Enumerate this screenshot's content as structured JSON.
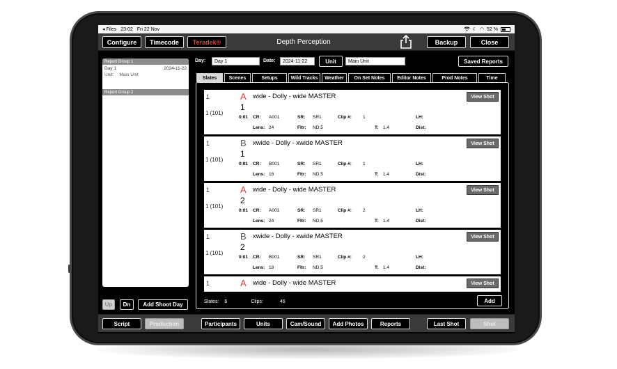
{
  "status_bar": {
    "app_back": "◂ Files",
    "time": "23:02",
    "date": "Fri 22 Nov",
    "battery_pct": "52 %",
    "battery_level": 0.52
  },
  "header": {
    "configure": "Configure",
    "timecode": "Timecode",
    "teradek": "Teradek®",
    "title": "Depth Perception",
    "backup": "Backup",
    "close": "Close"
  },
  "left_panel": {
    "groups": [
      {
        "header": "Report Group 1",
        "items": [
          {
            "name": "Day 1",
            "date": "2024-11-22",
            "unit_label": "Unit:",
            "unit_value": "Main Unit"
          }
        ]
      },
      {
        "header": "Report Group 2",
        "items": []
      }
    ],
    "up": "Up",
    "dn": "Dn",
    "add_shoot_day": "Add Shoot Day"
  },
  "filters": {
    "day_label": "Day:",
    "day_value": "Day 1",
    "date_label": "Date:",
    "date_value": "2024-11-22",
    "unit_button": "Unit",
    "unit_value": "Main Unit",
    "saved_reports": "Saved Reports"
  },
  "tabs": [
    {
      "label": "Slates",
      "active": true
    },
    {
      "label": "Scenes",
      "active": false
    },
    {
      "label": "Setups",
      "active": false
    },
    {
      "label": "Wild Tracks",
      "active": false
    },
    {
      "label": "Weather",
      "active": false
    },
    {
      "label": "On Set Notes",
      "active": false
    },
    {
      "label": "Editor Notes",
      "active": false
    },
    {
      "label": "Prod Notes",
      "active": false
    },
    {
      "label": "Time",
      "active": false
    }
  ],
  "field_labels": {
    "cr": "CR:",
    "sr": "SR:",
    "clip": "Clip #:",
    "lh": "LH:",
    "lens": "Lens:",
    "fltr": "Fltr:",
    "t": "T:",
    "dist": "Dist:"
  },
  "slates": [
    {
      "scene": "1",
      "letter": "A",
      "letter_color": "#e23b3b",
      "title": "wide - Dolly - wide MASTER",
      "take": "1",
      "take_id": "1 (101)",
      "duration": "0:01",
      "cr": "A001",
      "sr": "SR1",
      "clip": "1",
      "lh": "",
      "lens": "24",
      "fltr": "ND.5",
      "t": "1.4",
      "dist": "",
      "view": "View Shot"
    },
    {
      "scene": "1",
      "letter": "B",
      "letter_color": "#555555",
      "title": "xwide - Dolly - xwide MASTER",
      "take": "1",
      "take_id": "1 (101)",
      "duration": "0:01",
      "cr": "B001",
      "sr": "SR1",
      "clip": "1",
      "lh": "",
      "lens": "18",
      "fltr": "ND.5",
      "t": "1.4",
      "dist": "",
      "view": "View Shot"
    },
    {
      "scene": "1",
      "letter": "A",
      "letter_color": "#e23b3b",
      "title": "wide - Dolly - wide MASTER",
      "take": "2",
      "take_id": "1 (101)",
      "duration": "0:01",
      "cr": "A001",
      "sr": "SR1",
      "clip": "2",
      "lh": "",
      "lens": "24",
      "fltr": "ND.5",
      "t": "1.4",
      "dist": "",
      "view": "View Shot"
    },
    {
      "scene": "1",
      "letter": "B",
      "letter_color": "#555555",
      "title": "xwide - Dolly - xwide MASTER",
      "take": "2",
      "take_id": "1 (101)",
      "duration": "0:01",
      "cr": "B001",
      "sr": "SR1",
      "clip": "2",
      "lh": "",
      "lens": "18",
      "fltr": "ND.5",
      "t": "1.4",
      "dist": "",
      "view": "View Shot"
    },
    {
      "scene": "1",
      "letter": "A",
      "letter_color": "#e23b3b",
      "title": "wide - Dolly - wide MASTER",
      "take": "",
      "take_id": "",
      "duration": "",
      "cr": "",
      "sr": "",
      "clip": "",
      "lh": "",
      "lens": "",
      "fltr": "",
      "t": "",
      "dist": "",
      "view": "View Shot"
    }
  ],
  "summary": {
    "slates_label": "Slates:",
    "slates_value": "6",
    "clips_label": "Clips:",
    "clips_value": "46",
    "add": "Add"
  },
  "bottom_bar": {
    "script": "Script",
    "production": "Production",
    "participants": "Participants",
    "units": "Units",
    "cam_sound": "Cam/Sound",
    "add_photos": "Add Photos",
    "reports": "Reports",
    "last_shot": "Last Shot",
    "shot": "Shot"
  }
}
